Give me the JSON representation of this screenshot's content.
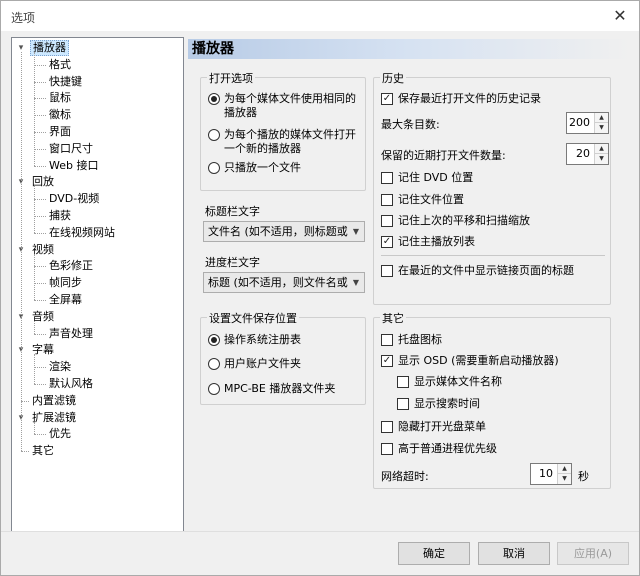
{
  "window": {
    "title": "选项",
    "close_glyph": "✕"
  },
  "tree": {
    "items": [
      {
        "label": "播放器",
        "level": 0,
        "expanded": true,
        "selected": true
      },
      {
        "label": "格式",
        "level": 1
      },
      {
        "label": "快捷键",
        "level": 1
      },
      {
        "label": "鼠标",
        "level": 1
      },
      {
        "label": "徽标",
        "level": 1
      },
      {
        "label": "界面",
        "level": 1
      },
      {
        "label": "窗口尺寸",
        "level": 1
      },
      {
        "label": "Web 接口",
        "level": 1
      },
      {
        "label": "回放",
        "level": 0,
        "expanded": true
      },
      {
        "label": "DVD-视频",
        "level": 1
      },
      {
        "label": "捕获",
        "level": 1
      },
      {
        "label": "在线视频网站",
        "level": 1
      },
      {
        "label": "视频",
        "level": 0,
        "expanded": true
      },
      {
        "label": "色彩修正",
        "level": 1
      },
      {
        "label": "帧同步",
        "level": 1
      },
      {
        "label": "全屏幕",
        "level": 1
      },
      {
        "label": "音频",
        "level": 0,
        "expanded": true
      },
      {
        "label": "声音处理",
        "level": 1
      },
      {
        "label": "字幕",
        "level": 0,
        "expanded": true
      },
      {
        "label": "渲染",
        "level": 1
      },
      {
        "label": "默认风格",
        "level": 1
      },
      {
        "label": "内置滤镜",
        "level": 0
      },
      {
        "label": "扩展滤镜",
        "level": 0,
        "expanded": true
      },
      {
        "label": "优先",
        "level": 1
      },
      {
        "label": "其它",
        "level": 0
      }
    ],
    "toggle_glyph": "▾"
  },
  "page": {
    "title": "播放器",
    "open_options": {
      "title": "打开选项",
      "options": [
        {
          "label": "为每个媒体文件使用相同的播放器",
          "checked": true
        },
        {
          "label": "为每个播放的媒体文件打开一个新的播放器",
          "checked": false
        },
        {
          "label": "只播放一个文件",
          "checked": false
        }
      ]
    },
    "title_bar_text": {
      "label": "标题栏文字",
      "value": "文件名 (如不适用，则标题或网站)"
    },
    "progress_bar_text": {
      "label": "进度栏文字",
      "value": "标题 (如不适用，则文件名或网站)"
    },
    "settings_location": {
      "title": "设置文件保存位置",
      "options": [
        {
          "label": "操作系统注册表",
          "checked": true
        },
        {
          "label": "用户账户文件夹",
          "checked": false
        },
        {
          "label": "MPC-BE 播放器文件夹",
          "checked": false
        }
      ]
    },
    "history": {
      "title": "历史",
      "keep_history": {
        "label": "保存最近打开文件的历史记录",
        "checked": true
      },
      "max_entries": {
        "label": "最大条目数:",
        "value": "200"
      },
      "recent_count": {
        "label": "保留的近期打开文件数量:",
        "value": "20"
      },
      "remember_dvd": {
        "label": "记住 DVD 位置",
        "checked": false
      },
      "remember_file": {
        "label": "记住文件位置",
        "checked": false
      },
      "remember_pan": {
        "label": "记住上次的平移和扫描缩放",
        "checked": false
      },
      "remember_playlist": {
        "label": "记住主播放列表",
        "checked": true
      },
      "show_page_title": {
        "label": "在最近的文件中显示链接页面的标题",
        "checked": false
      }
    },
    "other": {
      "title": "其它",
      "tray_icon": {
        "label": "托盘图标",
        "checked": false
      },
      "show_osd": {
        "label": "显示 OSD (需要重新启动播放器)",
        "checked": true
      },
      "show_filename": {
        "label": "显示媒体文件名称",
        "checked": false
      },
      "show_seek_time": {
        "label": "显示搜索时间",
        "checked": false
      },
      "hide_disc_menu": {
        "label": "隐藏打开光盘菜单",
        "checked": false
      },
      "high_priority": {
        "label": "高于普通进程优先级",
        "checked": false
      },
      "network_timeout": {
        "label": "网络超时:",
        "value": "10",
        "unit": "秒"
      }
    }
  },
  "buttons": {
    "ok": "确定",
    "cancel": "取消",
    "apply": "应用(A)"
  },
  "glyphs": {
    "check": "✓",
    "spin_up": "▲",
    "spin_down": "▼",
    "combo_arrow": "▼"
  }
}
